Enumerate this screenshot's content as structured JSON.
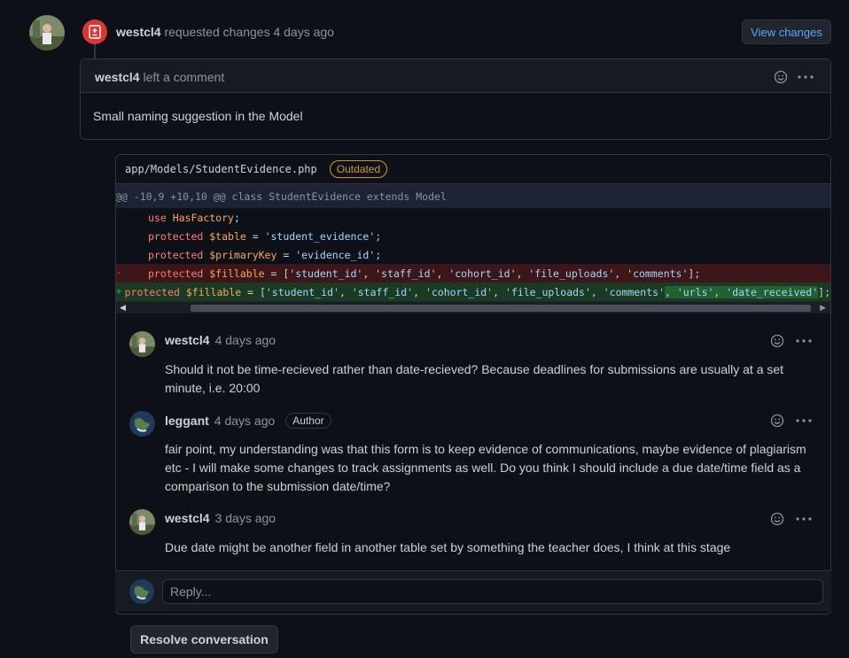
{
  "review": {
    "user": "westcl4",
    "action": "requested changes",
    "time": "4 days ago",
    "view_changes_label": "View changes"
  },
  "top_comment": {
    "user": "westcl4",
    "action": "left a comment",
    "body": "Small naming suggestion in the Model"
  },
  "file": {
    "path": "app/Models/StudentEvidence.php",
    "badge": "Outdated",
    "hunk": "@@ -10,9 +10,10 @@ class StudentEvidence extends Model",
    "lines": [
      {
        "type": "ctx",
        "sign": "",
        "tokens": [
          {
            "c": "kw",
            "t": "use "
          },
          {
            "c": "var",
            "t": "HasFactory"
          },
          {
            "c": "pl",
            "t": ";"
          }
        ]
      },
      {
        "type": "ctx",
        "sign": "",
        "tokens": [
          {
            "c": "kw",
            "t": "protected "
          },
          {
            "c": "var",
            "t": "$table"
          },
          {
            "c": "pl",
            "t": " = "
          },
          {
            "c": "str",
            "t": "'student_evidence'"
          },
          {
            "c": "pl",
            "t": ";"
          }
        ]
      },
      {
        "type": "ctx",
        "sign": "",
        "tokens": [
          {
            "c": "kw",
            "t": "protected "
          },
          {
            "c": "var",
            "t": "$primaryKey"
          },
          {
            "c": "pl",
            "t": " = "
          },
          {
            "c": "str",
            "t": "'evidence_id'"
          },
          {
            "c": "pl",
            "t": ";"
          }
        ]
      },
      {
        "type": "del",
        "sign": "-",
        "tokens": [
          {
            "c": "kw",
            "t": "protected "
          },
          {
            "c": "var",
            "t": "$fillable"
          },
          {
            "c": "pl",
            "t": " = ["
          },
          {
            "c": "str",
            "t": "'student_id'"
          },
          {
            "c": "pl",
            "t": ", "
          },
          {
            "c": "str",
            "t": "'staff_id'"
          },
          {
            "c": "pl",
            "t": ", "
          },
          {
            "c": "str",
            "t": "'cohort_id'"
          },
          {
            "c": "pl",
            "t": ", "
          },
          {
            "c": "str",
            "t": "'file_uploads'"
          },
          {
            "c": "pl",
            "t": ", "
          },
          {
            "c": "str",
            "t": "'comments'"
          },
          {
            "c": "pl",
            "t": "];"
          }
        ]
      },
      {
        "type": "add",
        "sign": "+",
        "tokens": [
          {
            "c": "kw",
            "t": "protected "
          },
          {
            "c": "var",
            "t": "$fillable"
          },
          {
            "c": "pl",
            "t": " = ["
          },
          {
            "c": "str",
            "t": "'student_id'"
          },
          {
            "c": "pl",
            "t": ", "
          },
          {
            "c": "str",
            "t": "'staff_id'"
          },
          {
            "c": "pl",
            "t": ", "
          },
          {
            "c": "str",
            "t": "'cohort_id'"
          },
          {
            "c": "pl",
            "t": ", "
          },
          {
            "c": "str",
            "t": "'file_uploads'"
          },
          {
            "c": "pl",
            "t": ", "
          },
          {
            "c": "str",
            "t": "'comments'"
          },
          {
            "c": "pl hl",
            "t": ", "
          },
          {
            "c": "str hl",
            "t": "'urls'"
          },
          {
            "c": "pl hl",
            "t": ", "
          },
          {
            "c": "str hl",
            "t": "'date_received'"
          },
          {
            "c": "pl",
            "t": "];"
          }
        ]
      }
    ]
  },
  "thread": [
    {
      "user": "westcl4",
      "time": "4 days ago",
      "badge": "",
      "body": "Should it not be time-recieved rather than date-recieved? Because deadlines for submissions are usually at a set minute, i.e. 20:00"
    },
    {
      "user": "leggant",
      "time": "4 days ago",
      "badge": "Author",
      "body": "fair point, my understanding was that this form is to keep evidence of communications, maybe evidence of plagiarism etc - I will make some changes to track assignments as well. Do you think I should include a due date/time field as a comparison to the submission date/time?"
    },
    {
      "user": "westcl4",
      "time": "3 days ago",
      "badge": "",
      "body": "Due date might be another field in another table set by something the teacher does, I think at this stage"
    }
  ],
  "reply": {
    "placeholder": "Reply..."
  },
  "resolve_label": "Resolve conversation",
  "colors": {
    "request_changes": "#da3633",
    "link": "#58a6ff",
    "outdated": "#d29922"
  }
}
